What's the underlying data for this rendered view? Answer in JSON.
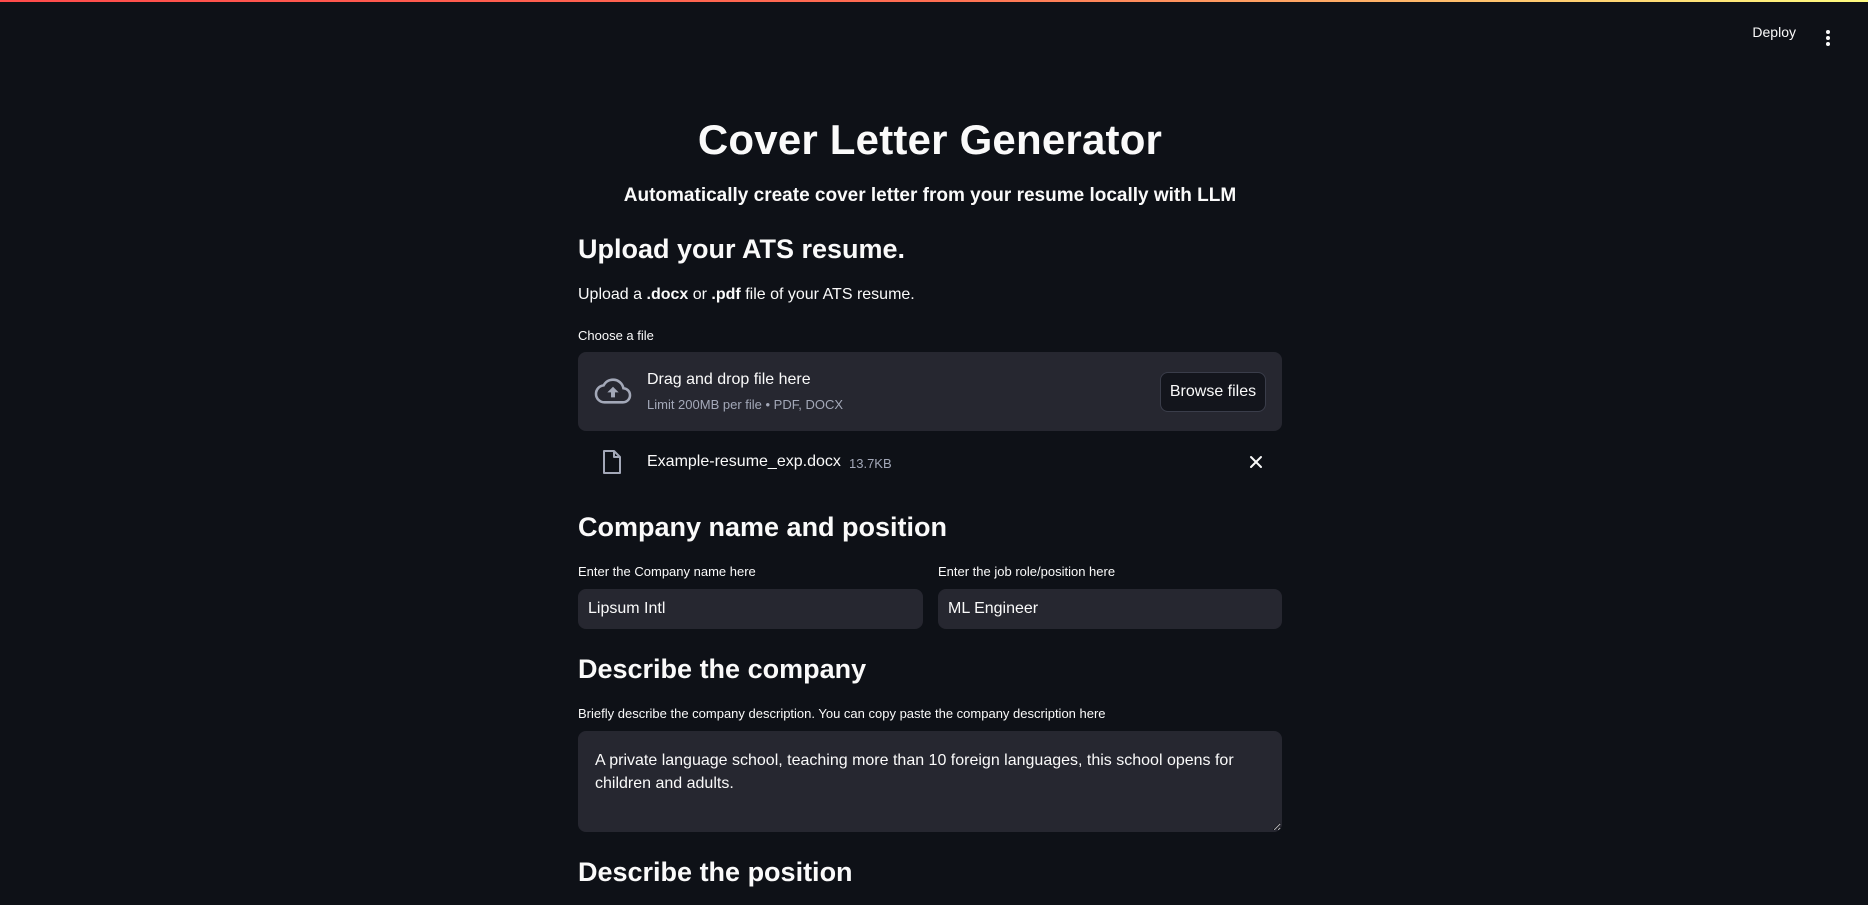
{
  "header": {
    "deploy_label": "Deploy",
    "menu_icon": "kebab-menu-icon"
  },
  "page": {
    "title": "Cover Letter Generator",
    "subtitle": "Automatically create cover letter from your resume locally with LLM"
  },
  "upload": {
    "heading": "Upload your ATS resume.",
    "instruction_prefix": "Upload a ",
    "instruction_docx": ".docx",
    "instruction_or": " or ",
    "instruction_pdf": ".pdf",
    "instruction_suffix": " file of your ATS resume.",
    "label": "Choose a file",
    "dropzone_title": "Drag and drop file here",
    "dropzone_subtitle": "Limit 200MB per file • PDF, DOCX",
    "browse_label": "Browse files",
    "file_name": "Example-resume_exp.docx",
    "file_size": "13.7KB"
  },
  "company": {
    "heading": "Company name and position",
    "name_label": "Enter the Company name here",
    "name_value": "Lipsum Intl",
    "role_label": "Enter the job role/position here",
    "role_value": "ML Engineer"
  },
  "describe_company": {
    "heading": "Describe the company",
    "label": "Briefly describe the company description. You can copy paste the company description here",
    "value": "A private language school, teaching more than 10 foreign languages, this school opens for children and adults."
  },
  "describe_position": {
    "heading": "Describe the position"
  },
  "colors": {
    "background": "#0e1117",
    "surface": "#262730",
    "text": "#fafafa",
    "muted": "#a3a8b8",
    "accent_start": "#ff4b4b",
    "accent_end": "#fffd80"
  }
}
